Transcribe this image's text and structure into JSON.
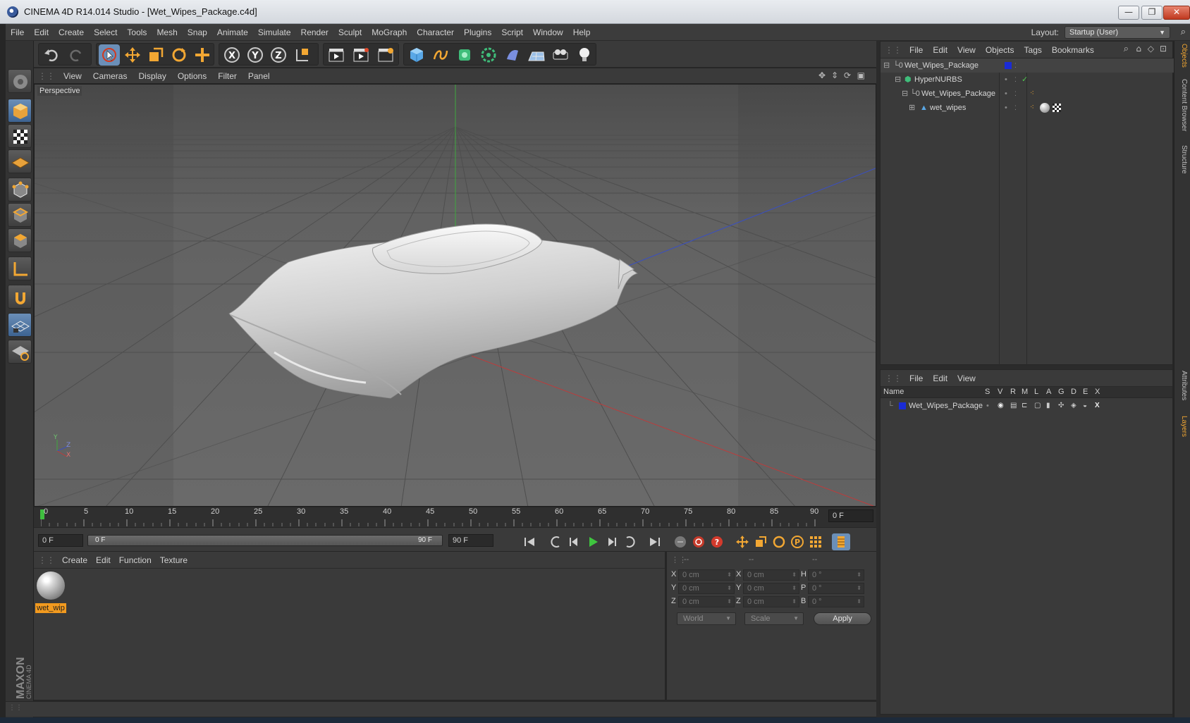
{
  "window": {
    "title": "CINEMA 4D R14.014 Studio - [Wet_Wipes_Package.c4d]",
    "min": "—",
    "max": "❐",
    "close": "✕"
  },
  "menubar": {
    "items": [
      "File",
      "Edit",
      "Create",
      "Select",
      "Tools",
      "Mesh",
      "Snap",
      "Animate",
      "Simulate",
      "Render",
      "Sculpt",
      "MoGraph",
      "Character",
      "Plugins",
      "Script",
      "Window",
      "Help"
    ],
    "layout_label": "Layout:",
    "layout_value": "Startup (User)"
  },
  "viewport": {
    "menu": [
      "View",
      "Cameras",
      "Display",
      "Options",
      "Filter",
      "Panel"
    ],
    "label": "Perspective",
    "axis_y": "Y",
    "axis_z": "Z",
    "axis_x": "X"
  },
  "timeline": {
    "ticks": [
      "0",
      "5",
      "10",
      "15",
      "20",
      "25",
      "30",
      "35",
      "40",
      "45",
      "50",
      "55",
      "60",
      "65",
      "70",
      "75",
      "80",
      "85",
      "90"
    ],
    "current_frame": "0 F"
  },
  "transport": {
    "start_field": "0 F",
    "range_start": "0 F",
    "range_end": "90 F",
    "end_field": "90 F"
  },
  "material_manager": {
    "menu": [
      "Create",
      "Edit",
      "Function",
      "Texture"
    ],
    "materials": [
      {
        "name": "wet_wip"
      }
    ]
  },
  "coordinates": {
    "headers": [
      "--",
      "--",
      "--"
    ],
    "rows": [
      {
        "a": "X",
        "av": "0 cm",
        "b": "X",
        "bv": "0 cm",
        "c": "H",
        "cv": "0 °"
      },
      {
        "a": "Y",
        "av": "0 cm",
        "b": "Y",
        "bv": "0 cm",
        "c": "P",
        "cv": "0 °"
      },
      {
        "a": "Z",
        "av": "0 cm",
        "b": "Z",
        "bv": "0 cm",
        "c": "B",
        "cv": "0 °"
      }
    ],
    "space": "World",
    "mode": "Scale",
    "apply": "Apply"
  },
  "object_manager": {
    "menu": [
      "File",
      "Edit",
      "View",
      "Objects",
      "Tags",
      "Bookmarks"
    ],
    "objects": [
      {
        "name": "Wet_Wipes_Package",
        "level": 0
      },
      {
        "name": "HyperNURBS",
        "level": 1
      },
      {
        "name": "Wet_Wipes_Package",
        "level": 2
      },
      {
        "name": "wet_wipes",
        "level": 3
      }
    ]
  },
  "layer_manager": {
    "menu": [
      "File",
      "Edit",
      "View"
    ],
    "columns": [
      "Name",
      "S",
      "V",
      "R",
      "M",
      "L",
      "A",
      "G",
      "D",
      "E",
      "X"
    ],
    "layers": [
      {
        "name": "Wet_Wipes_Package",
        "color": "#1a2bd6"
      }
    ]
  },
  "side_tabs": [
    "Objects",
    "Content Browser",
    "Structure",
    "Attributes",
    "Layers"
  ],
  "branding": {
    "line1": "MAXON",
    "line2": "CINEMA 4D"
  },
  "colors": {
    "accent": "#f29a1f",
    "x_axis": "#c03a3a",
    "y_axis": "#3fa83f",
    "z_axis": "#3a4fc0",
    "selection": "#6b8fb8"
  }
}
